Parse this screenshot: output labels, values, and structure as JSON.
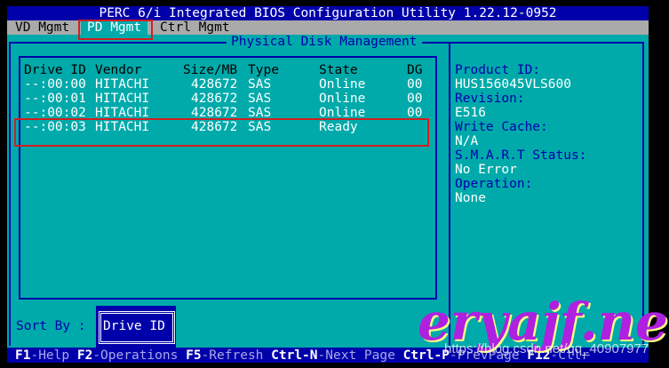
{
  "title": "PERC 6/i Integrated BIOS Configuration Utility 1.22.12-0952",
  "menu": [
    "VD Mgmt",
    "PD Mgmt",
    "Ctrl Mgmt"
  ],
  "panel_title": "Physical Disk Management",
  "columns": [
    "Drive ID",
    "Vendor",
    "Size/MB",
    "Type",
    "State",
    "DG"
  ],
  "rows": [
    [
      "--:00:00",
      "HITACHI",
      "428672",
      "SAS",
      "Online",
      "00"
    ],
    [
      "--:00:01",
      "HITACHI",
      "428672",
      "SAS",
      "Online",
      "00"
    ],
    [
      "--:00:02",
      "HITACHI",
      "428672",
      "SAS",
      "Online",
      "00"
    ],
    [
      "--:00:03",
      "HITACHI",
      "428672",
      "SAS",
      "Ready",
      ""
    ]
  ],
  "details": {
    "product_id_label": "Product ID:",
    "product_id": "HUS156045VLS600",
    "revision_label": "Revision:",
    "revision": "E516",
    "write_cache_label": "Write Cache:",
    "write_cache": "N/A",
    "smart_label": "S.M.A.R.T Status:",
    "smart": "No Error",
    "operation_label": "Operation:",
    "operation": "None"
  },
  "sort_by_label": "Sort By :",
  "sort_by_value": "Drive ID",
  "footer": [
    [
      "F1",
      "-Help"
    ],
    [
      "F2",
      "-Operations"
    ],
    [
      "F5",
      "-Refresh"
    ],
    [
      "Ctrl-N",
      "-Next Page"
    ],
    [
      "Ctrl-P",
      "-PrevPage"
    ],
    [
      "F12",
      "-Ctlr"
    ]
  ],
  "watermark": "eryajf.net",
  "watermark_url": "https://blog.csdn.net/qq_40907977"
}
